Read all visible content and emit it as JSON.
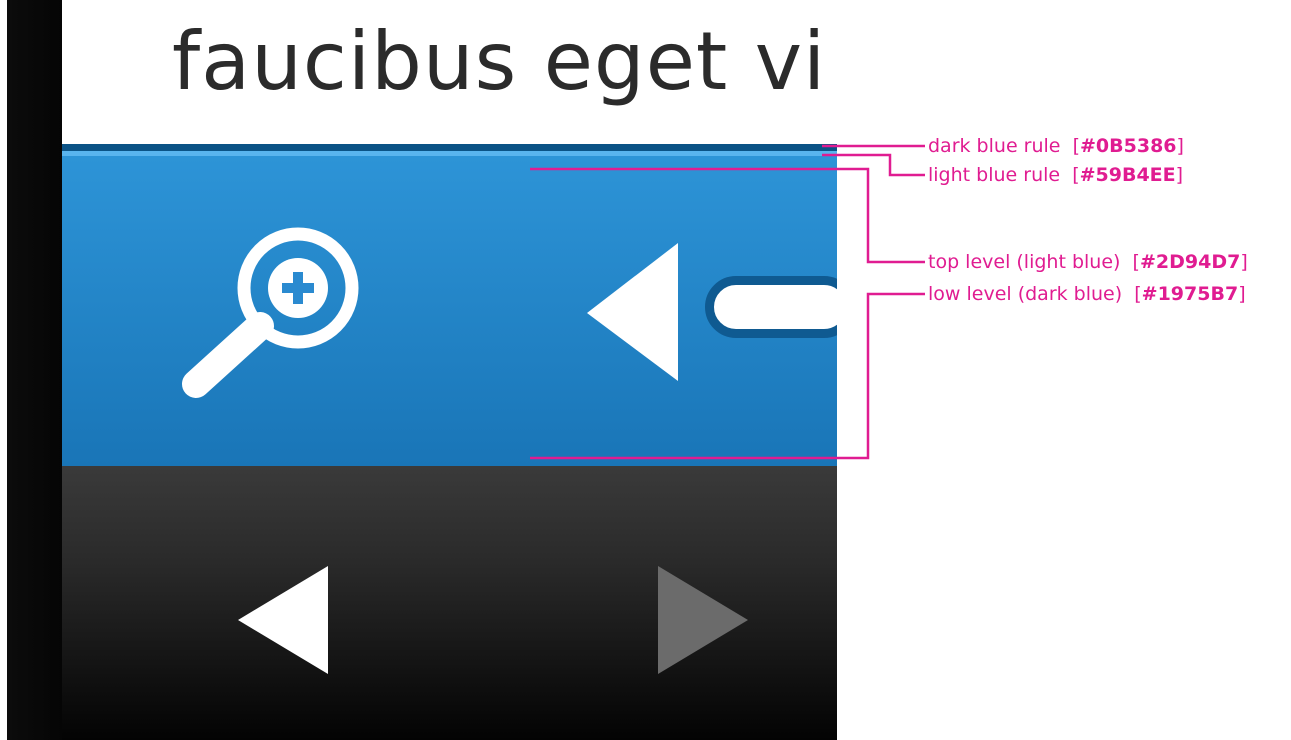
{
  "mockup": {
    "title_text": "faucibus eget vi",
    "colors": {
      "dark_blue_rule": "#0B5386",
      "light_blue_rule": "#59B4EE",
      "toolbar_top": "#2D94D7",
      "toolbar_bottom": "#1975B7"
    },
    "toolbar": {
      "zoom_icon": "zoom-in-icon",
      "prev_icon": "triangle-left-icon",
      "slider": "slider-track"
    },
    "navbar": {
      "prev_icon": "triangle-left-icon",
      "next_icon": "triangle-right-icon"
    }
  },
  "annotations": [
    {
      "label": "dark blue rule",
      "color_code": "#0B5386"
    },
    {
      "label": "light blue rule",
      "color_code": "#59B4EE"
    },
    {
      "label": "top level (light blue)",
      "color_code": "#2D94D7"
    },
    {
      "label": "low level (dark blue)",
      "color_code": "#1975B7"
    }
  ]
}
